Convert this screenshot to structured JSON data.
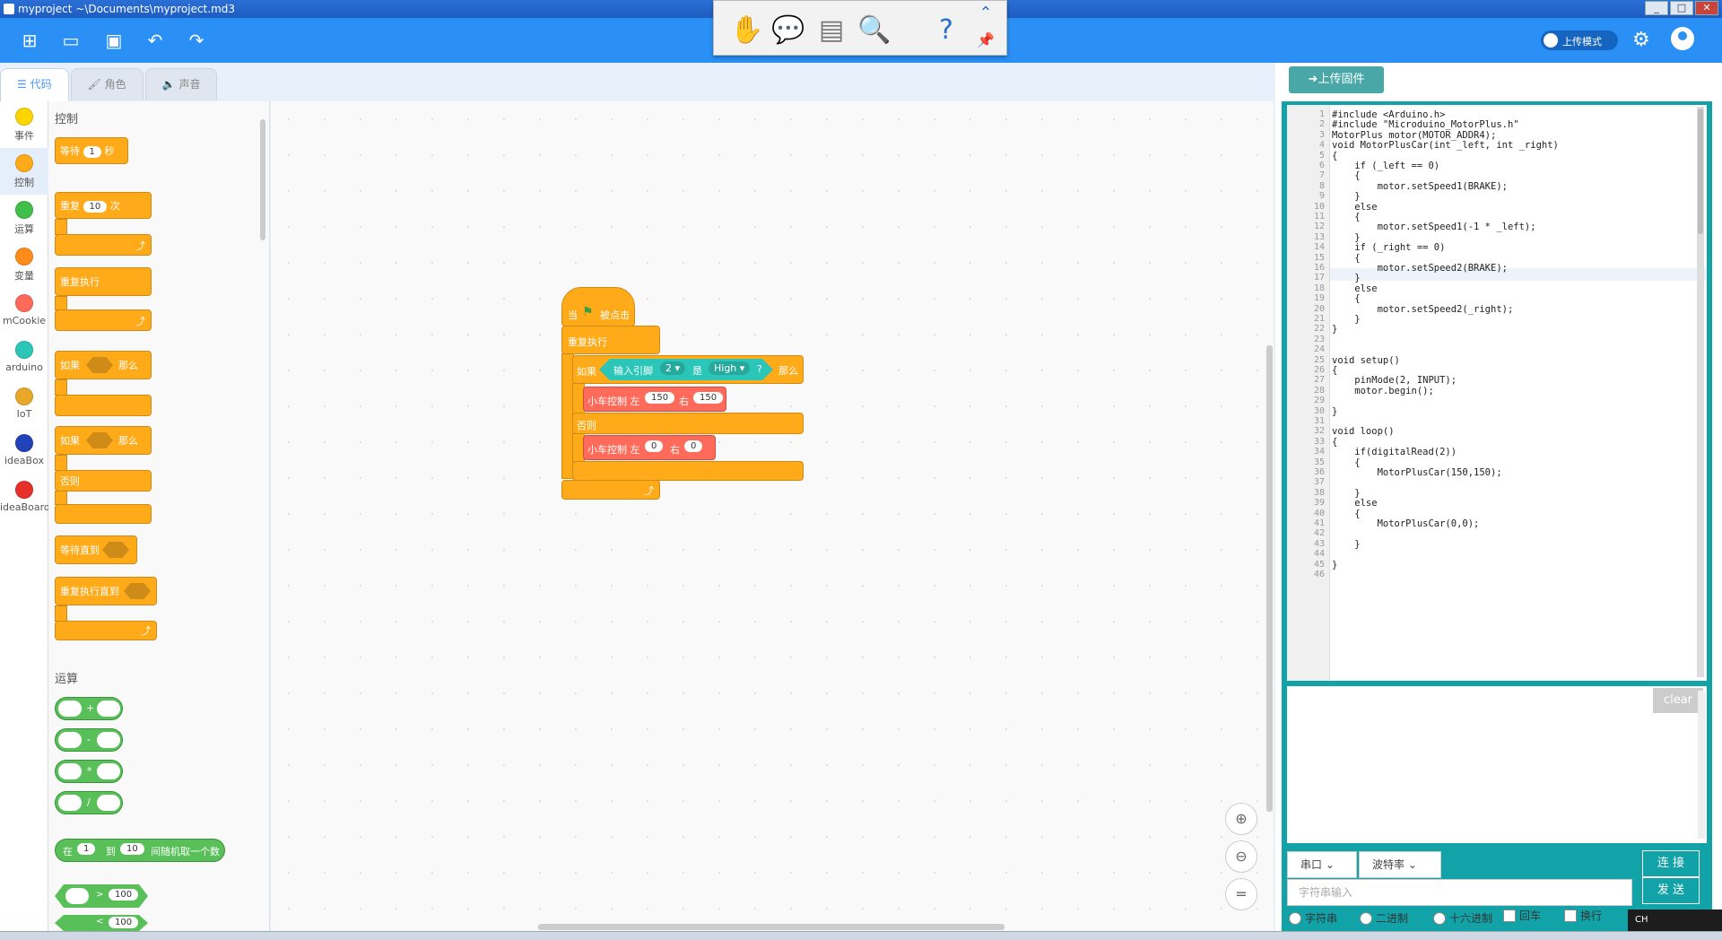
{
  "window": {
    "title": "myproject ~\\Documents\\myproject.md3",
    "min": "_",
    "max": "□",
    "close": "✕"
  },
  "header": {
    "upload_mode": "上传模式"
  },
  "tabs": [
    {
      "label": "代码",
      "icon": "code-icon"
    },
    {
      "label": "角色",
      "icon": "brush-icon"
    },
    {
      "label": "声音",
      "icon": "speaker-icon"
    }
  ],
  "categories": [
    {
      "label": "事件",
      "color": "#ffd500"
    },
    {
      "label": "控制",
      "color": "#ffab19"
    },
    {
      "label": "运算",
      "color": "#40bf4a"
    },
    {
      "label": "变量",
      "color": "#ff8c1a"
    },
    {
      "label": "mCookie",
      "color": "#ff6b5a"
    },
    {
      "label": "arduino",
      "color": "#2cc6b8"
    },
    {
      "label": "IoT",
      "color": "#e8a92a"
    },
    {
      "label": "ideaBox",
      "color": "#2242b8"
    },
    {
      "label": "ideaBoard",
      "color": "#e8302a"
    }
  ],
  "palette": {
    "control_heading": "控制",
    "wait": {
      "label": "等待",
      "value": "1",
      "unit": "秒"
    },
    "repeat": {
      "label": "重复",
      "value": "10",
      "unit": "次"
    },
    "forever": "重复执行",
    "if_then": {
      "if": "如果",
      "then": "那么"
    },
    "if_else": {
      "if": "如果",
      "then": "那么",
      "else": "否则"
    },
    "wait_until": "等待直到",
    "repeat_until": "重复执行直到",
    "operators_heading": "运算",
    "ops": [
      "+",
      "-",
      "*",
      "/"
    ],
    "random": {
      "prefix": "在",
      "from": "1",
      "to_word": "到",
      "to": "10",
      "suffix": "间随机取一个数"
    },
    "gt": {
      "sym": ">",
      "value": "100"
    },
    "lt": {
      "sym": "<",
      "value": "100"
    }
  },
  "script": {
    "hat_when": "当",
    "hat_clicked": "被点击",
    "forever": "重复执行",
    "if": "如果",
    "input_pin": "输入引脚",
    "pin": "2",
    "is": "是",
    "level": "High",
    "q": "?",
    "then": "那么",
    "car1": {
      "label": "小车控制 左",
      "left": "150",
      "right_label": "右",
      "right": "150"
    },
    "else": "否则",
    "car2": {
      "label": "小车控制 左",
      "left": "0",
      "right_label": "右",
      "right": "0"
    }
  },
  "right": {
    "upload_firmware": "➜上传固件",
    "clear": "clear",
    "port": "串口",
    "baud": "波特率",
    "connect": "连 接",
    "send": "发 送",
    "input_placeholder": "字符串输入",
    "options": [
      "字符串",
      "二进制",
      "十六进制"
    ],
    "checks": [
      "回车",
      "换行"
    ]
  },
  "code_lines": [
    "#include <Arduino.h>",
    "#include \"Microduino_MotorPlus.h\"",
    "MotorPlus motor(MOTOR_ADDR4);",
    "void MotorPlusCar(int _left, int _right)",
    "{",
    "    if (_left == 0)",
    "    {",
    "        motor.setSpeed1(BRAKE);",
    "    }",
    "    else",
    "    {",
    "        motor.setSpeed1(-1 * _left);",
    "    }",
    "    if (_right == 0)",
    "    {",
    "        motor.setSpeed2(BRAKE);",
    "    }",
    "    else",
    "    {",
    "        motor.setSpeed2(_right);",
    "    }",
    "}",
    "",
    "",
    "void setup()",
    "{",
    "    pinMode(2, INPUT);",
    "    motor.begin();",
    "",
    "}",
    "",
    "void loop()",
    "{",
    "    if(digitalRead(2))",
    "    {",
    "        MotorPlusCar(150,150);",
    "",
    "    }",
    "    else",
    "    {",
    "        MotorPlusCar(0,0);",
    "",
    "    }",
    "",
    "}",
    ""
  ],
  "tray": {
    "lang": "CH"
  }
}
